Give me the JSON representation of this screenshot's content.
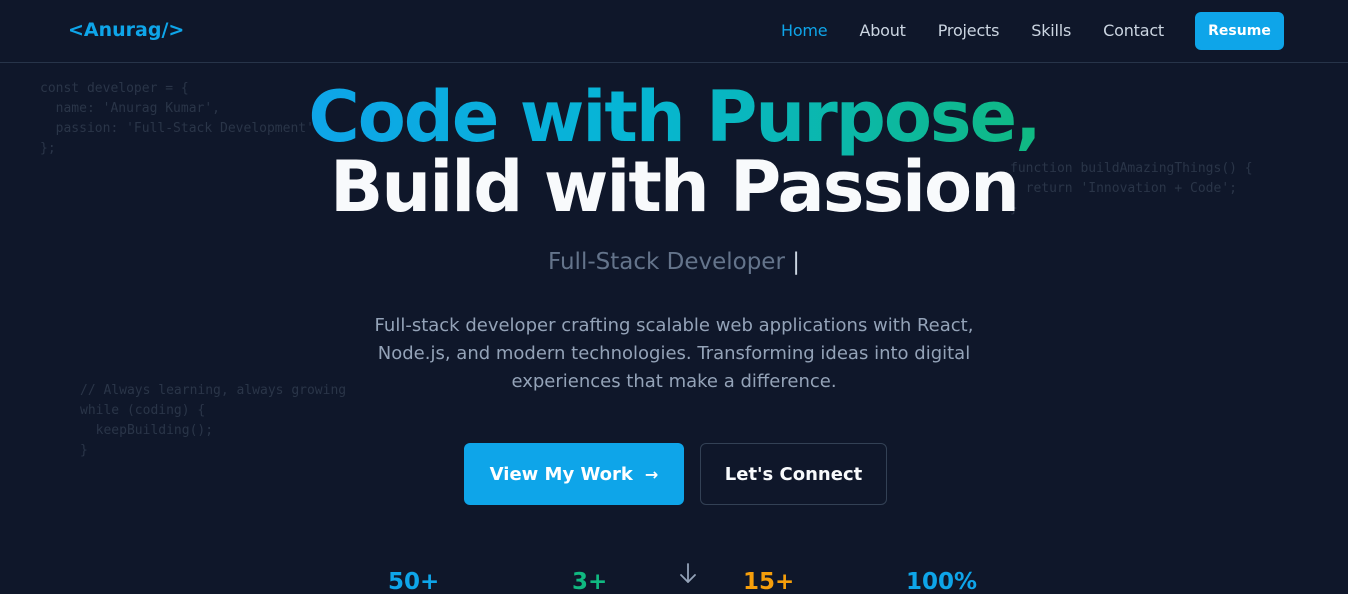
{
  "nav": {
    "logo": "<Anurag/>",
    "links": [
      {
        "label": "Home",
        "active": true
      },
      {
        "label": "About",
        "active": false
      },
      {
        "label": "Projects",
        "active": false
      },
      {
        "label": "Skills",
        "active": false
      },
      {
        "label": "Contact",
        "active": false
      }
    ],
    "resume_label": "Resume"
  },
  "code_snippets": {
    "snippet_1": "const developer = {\n  name: 'Anurag Kumar',\n  passion: 'Full-Stack Development'\n};",
    "snippet_2": "function buildAmazingThings() {\n  return 'Innovation + Code';\n}",
    "snippet_3": "// Always learning, always growing\nwhile (coding) {\n  keepBuilding();\n}"
  },
  "hero": {
    "title_line_1": "Code with Purpose,",
    "title_line_2": "Build with Passion",
    "subtitle": "Full-Stack Developer",
    "cursor": "|",
    "description": "Full-stack developer crafting scalable web applications with React, Node.js, and modern technologies. Transforming ideas into digital experiences that make a difference.",
    "primary_button": "View My Work",
    "secondary_button": "Let's Connect"
  },
  "stats": [
    "50+",
    "3+",
    "15+",
    "100%"
  ],
  "colors": {
    "background": "#0f172a",
    "accent": "#0ea5e9",
    "green": "#10b981",
    "amber": "#f59e0b"
  },
  "icons": {
    "primary_button_icon": "arrow-right-icon",
    "scroll_icon": "arrow-down-icon"
  }
}
